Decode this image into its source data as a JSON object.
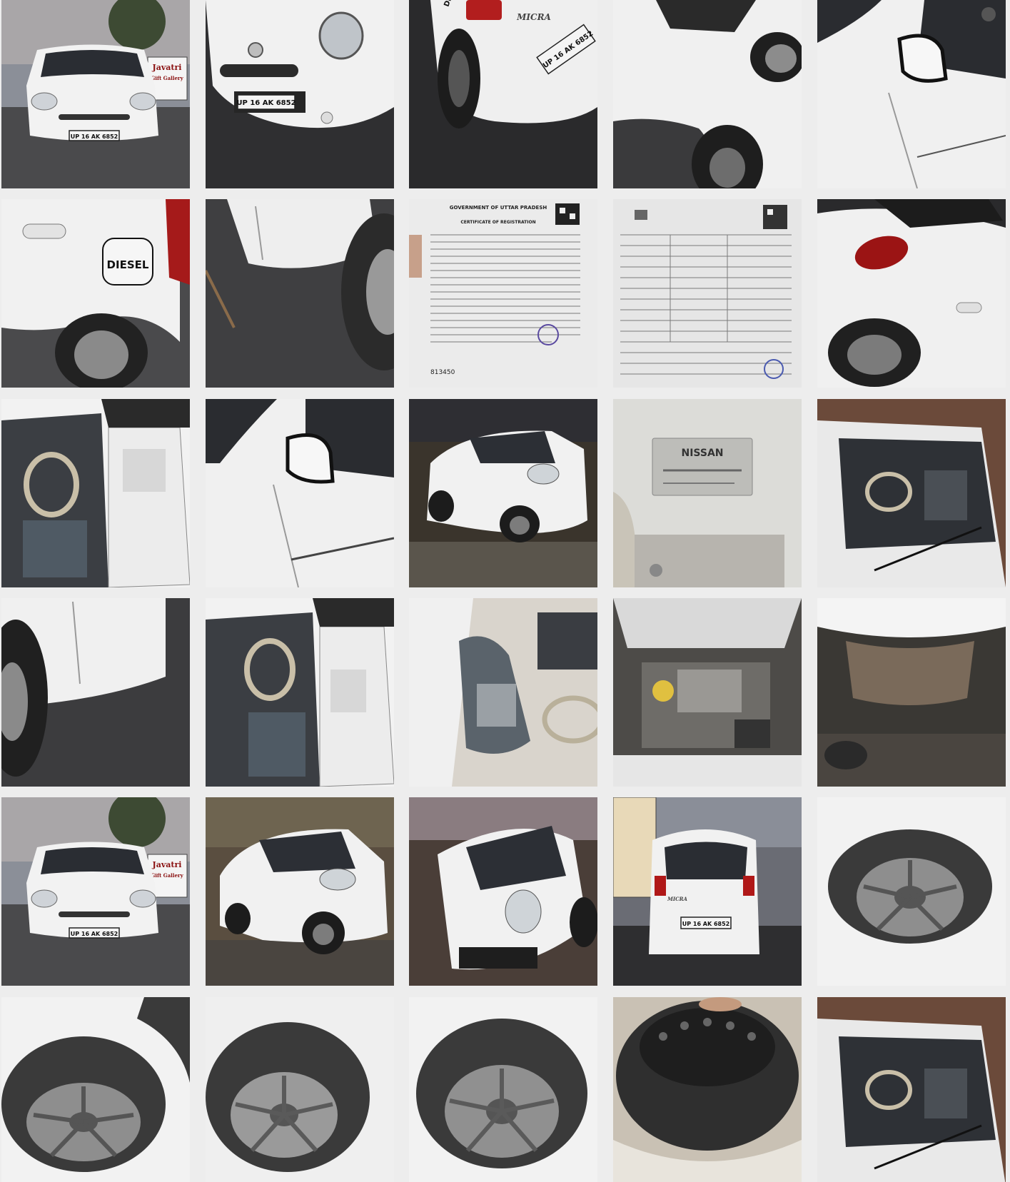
{
  "gallery": {
    "photos": [
      {
        "subject": "front-view-evening",
        "plate": "UP 16 AK 6852",
        "sign": [
          "Javatri",
          "Gift Gallery"
        ]
      },
      {
        "subject": "front-bumper-closeup",
        "plate": "UP 16 AK 6852"
      },
      {
        "subject": "rear-bumper-closeup",
        "plate": "UP 16 AK 6852",
        "badge": "MICRA",
        "sticker": "DIESEL"
      },
      {
        "subject": "front-left-fender"
      },
      {
        "subject": "left-door-mirror"
      },
      {
        "subject": "fuel-lid",
        "fuel_label": "DIESEL"
      },
      {
        "subject": "rear-side-door-lower"
      },
      {
        "subject": "registration-certificate",
        "doc_title": "GOVERNMENT OF UTTAR PRADESH",
        "doc_subtitle": "CERTIFICATE OF REGISTRATION",
        "serial": "813450"
      },
      {
        "subject": "insurance-policy-document"
      },
      {
        "subject": "rear-tail-light"
      },
      {
        "subject": "interior-driver-door-open"
      },
      {
        "subject": "side-door-mirror"
      },
      {
        "subject": "front-three-quarter-night"
      },
      {
        "subject": "chassis-vin-plate",
        "vin_brand": "NISSAN"
      },
      {
        "subject": "interior-through-windscreen"
      },
      {
        "subject": "rear-side-panel"
      },
      {
        "subject": "interior-driver-door-open-2"
      },
      {
        "subject": "front-seats"
      },
      {
        "subject": "engine-bay"
      },
      {
        "subject": "underbody"
      },
      {
        "subject": "front-view-dusk",
        "plate": "UP 16 AK 6852",
        "sign": [
          "Javatri",
          "Gift Gallery"
        ]
      },
      {
        "subject": "front-three-quarter-dusk"
      },
      {
        "subject": "front-low-angle"
      },
      {
        "subject": "rear-view-street",
        "plate": "UP 16 AK 6852",
        "badge": "MICRA"
      },
      {
        "subject": "tyre-front-left"
      },
      {
        "subject": "tyre-front-right"
      },
      {
        "subject": "tyre-rear-left"
      },
      {
        "subject": "tyre-rear-right"
      },
      {
        "subject": "spare-tyre"
      },
      {
        "subject": "interior-through-windscreen-2"
      }
    ]
  },
  "colors": {
    "background": "#ededed",
    "car_white": "#f2f2f2",
    "night": "#2a2a2e",
    "tyre": "#3a3a3a",
    "paper": "#eaeaea"
  }
}
